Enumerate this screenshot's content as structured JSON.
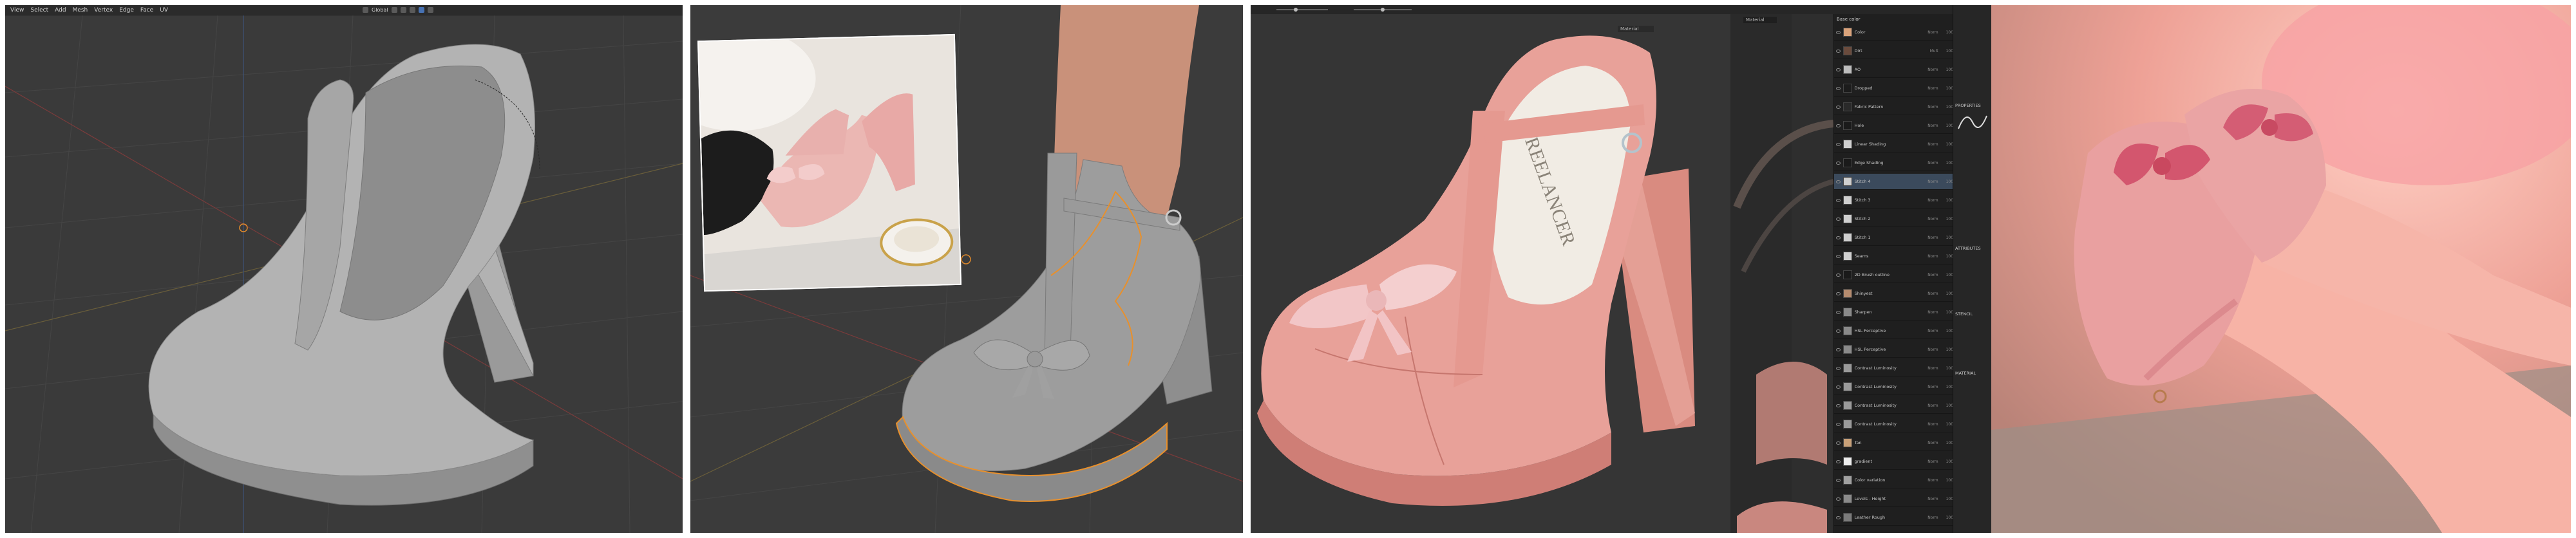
{
  "blender_modeling": {
    "menu": [
      "View",
      "Select",
      "Add",
      "Mesh",
      "Vertex",
      "Edge",
      "Face",
      "UV"
    ],
    "orientation_label": "Global"
  },
  "substance_painter": {
    "layers_tab": "Base color",
    "viewport_mode_left": "Material",
    "viewport_mode_right": "Material",
    "properties_title": "PROPERTIES",
    "properties_sections": [
      "ATTRIBUTES",
      "STENCIL",
      "MATERIAL"
    ],
    "insole_brand_text": "FREELANCER",
    "layers": [
      {
        "name": "Color",
        "blend": "Norm",
        "opacity": "100",
        "thumb": "#d9a27a"
      },
      {
        "name": "Dirt",
        "blend": "Mult",
        "opacity": "100",
        "thumb": "#6a4b3d"
      },
      {
        "name": "AO",
        "blend": "Norm",
        "opacity": "100",
        "thumb": "#bdbdbd"
      },
      {
        "name": "Dropped",
        "blend": "Norm",
        "opacity": "100",
        "thumb": "#1c1c1c"
      },
      {
        "name": "Fabric Pattern",
        "blend": "Norm",
        "opacity": "100",
        "thumb": "#2a2a2a"
      },
      {
        "name": "Hole",
        "blend": "Norm",
        "opacity": "100",
        "thumb": "#1a1a1a"
      },
      {
        "name": "Linear Shading",
        "blend": "Norm",
        "opacity": "100",
        "thumb": "#d0d0d0"
      },
      {
        "name": "Edge Shading",
        "blend": "Norm",
        "opacity": "100",
        "thumb": "#1a1a1a"
      },
      {
        "name": "Stitch 4",
        "blend": "Norm",
        "opacity": "100",
        "thumb": "#cfcfcf"
      },
      {
        "name": "Stitch 3",
        "blend": "Norm",
        "opacity": "100",
        "thumb": "#cfcfcf"
      },
      {
        "name": "Stitch 2",
        "blend": "Norm",
        "opacity": "100",
        "thumb": "#cfcfcf"
      },
      {
        "name": "Stitch 1",
        "blend": "Norm",
        "opacity": "100",
        "thumb": "#cfcfcf"
      },
      {
        "name": "Seams",
        "blend": "Norm",
        "opacity": "100",
        "thumb": "#cfcfcf"
      },
      {
        "name": "2D Brush outline",
        "blend": "Norm",
        "opacity": "100",
        "thumb": "#1a1a1a"
      },
      {
        "name": "Shinyest",
        "blend": "Norm",
        "opacity": "100",
        "thumb": "#b58b6e"
      },
      {
        "name": "Sharpen",
        "blend": "Norm",
        "opacity": "100",
        "thumb": "#8a8a8a"
      },
      {
        "name": "HSL Perceptive",
        "blend": "Norm",
        "opacity": "100",
        "thumb": "#8a8a8a"
      },
      {
        "name": "HSL Perceptive",
        "blend": "Norm",
        "opacity": "100",
        "thumb": "#8a8a8a"
      },
      {
        "name": "Contrast Luminosity",
        "blend": "Norm",
        "opacity": "100",
        "thumb": "#9a9a9a"
      },
      {
        "name": "Contrast Luminosity",
        "blend": "Norm",
        "opacity": "100",
        "thumb": "#9a9a9a"
      },
      {
        "name": "Contrast Luminosity",
        "blend": "Norm",
        "opacity": "100",
        "thumb": "#9a9a9a"
      },
      {
        "name": "Contrast Luminosity",
        "blend": "Norm",
        "opacity": "100",
        "thumb": "#9a9a9a"
      },
      {
        "name": "Tan",
        "blend": "Norm",
        "opacity": "100",
        "thumb": "#c8a078"
      },
      {
        "name": "gradient",
        "blend": "Norm",
        "opacity": "100",
        "thumb": "#ededed"
      },
      {
        "name": "Color variation",
        "blend": "Norm",
        "opacity": "100",
        "thumb": "#a0a0a0"
      },
      {
        "name": "Levels - Height",
        "blend": "Norm",
        "opacity": "100",
        "thumb": "#8a8a8a"
      },
      {
        "name": "Leather Rough",
        "blend": "Norm",
        "opacity": "100",
        "thumb": "#7a7a7a"
      }
    ]
  },
  "colors": {
    "shoe_pink": "#e9a49b",
    "bow_pink": "#f2c6c7",
    "blender_bg": "#3a3a3a",
    "clay_grey": "#a9a9a9",
    "selection_orange": "#e8902c"
  }
}
